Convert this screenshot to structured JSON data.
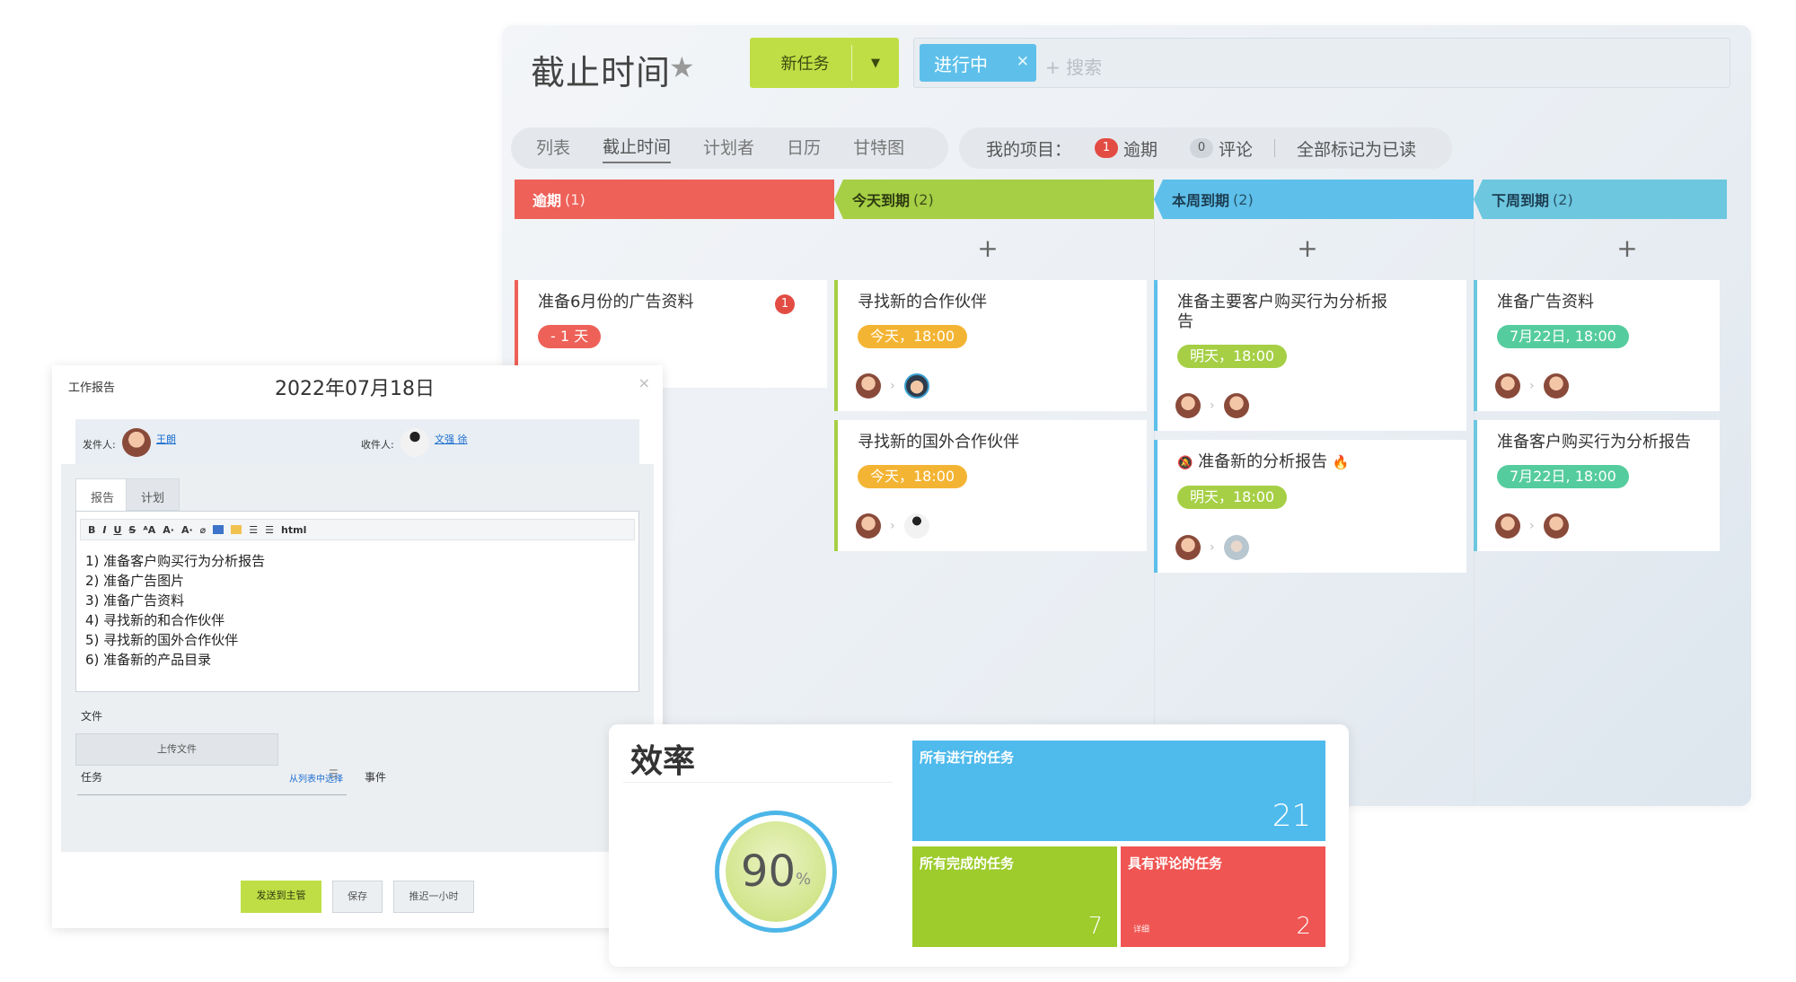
{
  "main": {
    "title": "截止时间",
    "new_task_label": "新任务",
    "filter_chip": "进行中",
    "search_placeholder": "+ 搜索",
    "tabs": [
      "列表",
      "截止时间",
      "计划者",
      "日历",
      "甘特图"
    ],
    "my_projects_label": "我的项目：",
    "overdue_count": "1",
    "overdue_label": "逾期",
    "comments_count": "0",
    "comments_label": "评论",
    "mark_all_read": "全部标记为已读"
  },
  "columns": [
    {
      "title": "逾期",
      "count": "(1)",
      "color": "#ee6158"
    },
    {
      "title": "今天到期",
      "count": "(2)",
      "color": "#a6cf45"
    },
    {
      "title": "本周到期",
      "count": "(2)",
      "color": "#5ec0ea"
    },
    {
      "title": "下周到期",
      "count": "(2)",
      "color": "#6cc7df"
    }
  ],
  "cards": {
    "overdue": {
      "title": "准备6月份的广告资料",
      "badge": "1",
      "pill": "- 1 天"
    },
    "today1": {
      "title": "寻找新的合作伙伴",
      "pill": "今天，18:00"
    },
    "today2": {
      "title": "寻找新的国外合作伙伴",
      "pill": "今天，18:00"
    },
    "week1": {
      "title": "准备主要客户购买行为分析报告",
      "pill": "明天，18:00"
    },
    "week2": {
      "title": "准备新的分析报告",
      "pill": "明天，18:00"
    },
    "next1": {
      "title": "准备广告资料",
      "pill": "7月22日, 18:00"
    },
    "next2": {
      "title": "准备客户购买行为分析报告",
      "pill": "7月22日, 18:00"
    }
  },
  "colors": {
    "lime": "#bfde45",
    "blue": "#5ec0ea",
    "red": "#ee6158",
    "orange": "#f4b433",
    "green": "#a6cf45"
  },
  "report": {
    "title": "工作报告",
    "date": "2022年07月18日",
    "sender_label": "发件人:",
    "sender_name": "王朗",
    "recipient_label": "收件人:",
    "recipient_name": "文强 徐",
    "tabs": [
      "报告",
      "计划"
    ],
    "toolbar_html": "html",
    "items": [
      "1)  准备客户购买行为分析报告",
      "2)  准备广告图片",
      "3)  准备广告资料",
      "4)  寻找新的和合作伙伴",
      "5)  寻找新的国外合作伙伴",
      "6)  准备新的产品目录"
    ],
    "files_label": "文件",
    "upload_label": "上传文件",
    "task_label": "任务",
    "pick_label": "从列表中选择",
    "event_label": "事件",
    "send_label": "发送到主管",
    "save_label": "保存",
    "postpone_label": "推迟一小时"
  },
  "efficiency": {
    "title": "效率",
    "percent": "90",
    "percent_sign": "%",
    "tiles": [
      {
        "label": "所有进行的任务",
        "value": "21"
      },
      {
        "label": "所有完成的任务",
        "value": "7"
      },
      {
        "label": "具有评论的任务",
        "value": "2",
        "detail": "详细"
      }
    ]
  }
}
